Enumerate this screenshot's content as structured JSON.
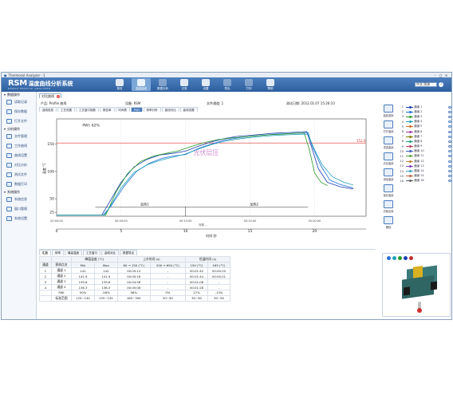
{
  "window": {
    "title": "Thermosol Analyzer - 1"
  },
  "banner": {
    "logo": "RSM",
    "product": "温度曲线分析系统",
    "subtitle": "RENSO PROFILE ANALYZER",
    "tools": [
      {
        "label": "首页",
        "selected": false,
        "dim": false
      },
      {
        "label": "温度曲线",
        "selected": true,
        "dim": false
      },
      {
        "label": "数据分析",
        "selected": false,
        "dim": true
      },
      {
        "label": "记录",
        "selected": false,
        "dim": false
      },
      {
        "label": "设置",
        "selected": false,
        "dim": false
      },
      {
        "label": "导出",
        "selected": false,
        "dim": true
      },
      {
        "label": "打印",
        "selected": false,
        "dim": true
      },
      {
        "label": "帮助",
        "selected": false,
        "dim": false
      }
    ],
    "search_value": "中文 简体"
  },
  "sidebar": {
    "groups": [
      {
        "title": "数据操作",
        "items": [
          "读取记录",
          "保存数据",
          "打开文件"
        ]
      },
      {
        "title": "分析操作",
        "items": [
          "文件管理",
          "工作曲线",
          "曲线设置",
          "对比分析",
          "测试文件",
          "数据打印"
        ]
      },
      {
        "title": "系统操作",
        "items": [
          "系统信息",
          "窗口管理",
          "系统设置"
        ]
      }
    ]
  },
  "tab": {
    "label": "对比曲线"
  },
  "info": {
    "product": "产品: Profile 曲线",
    "device": "设备: RSM",
    "file": "文件通道: 1",
    "date": "测试日期: 2012.01.07 15:26:10"
  },
  "subtabs": [
    "曲线信息",
    "工艺设置",
    "工艺窗口指数",
    "报告单",
    "时间表",
    "PWI",
    "斜率分析",
    "曲线对比",
    "曲线设置"
  ],
  "subtab_active": 5,
  "chart_data": {
    "type": "line",
    "annotation_top": "PWI: 62%",
    "watermark": "光伏层压",
    "ylabel": "温度 °C",
    "xlabel": "时间 秒",
    "yticks": [
      "150",
      "100",
      "50",
      "25"
    ],
    "xticks": [
      "0",
      "5",
      "10",
      "15",
      "20"
    ],
    "time_labels": [
      "00:00:00",
      "00:05:00",
      "00:10:00",
      "00:15:00",
      "00:20:00"
    ],
    "limit_line": {
      "value": 152,
      "label": "152.0"
    },
    "zone_labels": [
      "加热1",
      "加热2"
    ],
    "bottom_zone": "冷却 ...",
    "ylim": [
      18,
      196
    ],
    "xlim": [
      0,
      24
    ],
    "series": [
      {
        "color": "#1a3fb0",
        "values": [
          [
            0,
            20
          ],
          [
            2,
            20
          ],
          [
            3.5,
            20
          ],
          [
            4,
            40
          ],
          [
            5,
            80
          ],
          [
            6,
            108
          ],
          [
            7,
            122
          ],
          [
            8,
            130
          ],
          [
            9,
            133
          ],
          [
            10,
            137
          ],
          [
            11,
            146
          ],
          [
            12,
            154
          ],
          [
            13,
            160
          ],
          [
            14,
            164
          ],
          [
            15,
            166
          ],
          [
            16,
            168
          ],
          [
            17,
            170
          ],
          [
            18,
            171
          ],
          [
            19,
            172
          ],
          [
            19.4,
            173
          ],
          [
            19.7,
            150
          ],
          [
            20.3,
            105
          ],
          [
            21,
            80
          ],
          [
            22,
            72
          ],
          [
            23,
            68
          ]
        ]
      },
      {
        "color": "#1e6fd6",
        "values": [
          [
            0,
            20
          ],
          [
            2,
            20
          ],
          [
            3.6,
            20
          ],
          [
            4.2,
            36
          ],
          [
            5.2,
            72
          ],
          [
            6.2,
            100
          ],
          [
            7.2,
            115
          ],
          [
            8.2,
            124
          ],
          [
            9,
            128
          ],
          [
            10,
            131
          ],
          [
            11,
            142
          ],
          [
            12,
            150
          ],
          [
            13,
            157
          ],
          [
            14,
            161
          ],
          [
            15,
            164
          ],
          [
            16,
            166
          ],
          [
            17,
            168
          ],
          [
            18,
            169
          ],
          [
            19,
            170
          ],
          [
            19.5,
            171
          ],
          [
            19.8,
            148
          ],
          [
            20.5,
            110
          ],
          [
            21.2,
            84
          ],
          [
            22,
            76
          ],
          [
            23,
            70
          ]
        ]
      },
      {
        "color": "#2a9a2a",
        "values": [
          [
            0,
            20
          ],
          [
            2,
            20
          ],
          [
            3.8,
            20
          ],
          [
            4,
            30
          ],
          [
            4.6,
            62
          ],
          [
            5.5,
            96
          ],
          [
            6.5,
            118
          ],
          [
            7.5,
            128
          ],
          [
            8.5,
            133
          ],
          [
            9.5,
            138
          ],
          [
            10.5,
            146
          ],
          [
            11.5,
            153
          ],
          [
            12.5,
            158
          ],
          [
            13.5,
            161
          ],
          [
            14.5,
            163
          ],
          [
            15.5,
            165
          ],
          [
            16.5,
            167
          ],
          [
            17.5,
            168
          ],
          [
            18.5,
            170
          ],
          [
            19.2,
            170
          ],
          [
            19.6,
            140
          ],
          [
            20,
            98
          ],
          [
            20.5,
            80
          ],
          [
            21,
            74
          ]
        ]
      },
      {
        "color": "#1fa0b8",
        "values": [
          [
            0,
            20
          ],
          [
            2,
            20
          ],
          [
            3.7,
            20
          ],
          [
            4.1,
            34
          ],
          [
            5,
            70
          ],
          [
            6,
            98
          ],
          [
            7,
            112
          ],
          [
            8,
            120
          ],
          [
            9,
            126
          ],
          [
            10,
            132
          ],
          [
            11,
            141
          ],
          [
            12,
            149
          ],
          [
            13,
            155
          ],
          [
            14,
            159
          ],
          [
            15,
            162
          ],
          [
            16,
            164
          ],
          [
            17,
            166
          ],
          [
            18,
            167
          ],
          [
            19,
            168
          ],
          [
            19.5,
            168
          ],
          [
            19.9,
            145
          ],
          [
            20.6,
            112
          ],
          [
            21.4,
            90
          ],
          [
            22.3,
            80
          ],
          [
            23,
            75
          ]
        ]
      }
    ]
  },
  "right_tools": [
    "曲线选择",
    "打开曲线",
    "重选曲线",
    "清空曲线",
    "添加曲线",
    "保存曲线",
    "清除区域",
    "删除"
  ],
  "legend": [
    {
      "n": "1",
      "name": "通道 1",
      "color": "#1a3fb0"
    },
    {
      "n": "2",
      "name": "通道 2",
      "color": "#1e6fd6"
    },
    {
      "n": "3",
      "name": "通道 3",
      "color": "#2a9a2a"
    },
    {
      "n": "4",
      "name": "通道 4",
      "color": "#1fa0b8"
    },
    {
      "n": "5",
      "name": "通道 5",
      "color": "#d07020"
    },
    {
      "n": "6",
      "name": "通道 6",
      "color": "#a040a0"
    },
    {
      "n": "7",
      "name": "通道 7",
      "color": "#808000"
    },
    {
      "n": "8",
      "name": "通道 8",
      "color": "#20a080"
    },
    {
      "n": "9",
      "name": "通道 9",
      "color": "#c04060"
    },
    {
      "n": "10",
      "name": "通道 10",
      "color": "#4060c0"
    },
    {
      "n": "11",
      "name": "通道 11",
      "color": "#60a040"
    },
    {
      "n": "12",
      "name": "通道 12",
      "color": "#c08040"
    },
    {
      "n": "13",
      "name": "通道 13",
      "color": "#8040c0"
    },
    {
      "n": "14",
      "name": "通道 14",
      "color": "#40a0c0"
    },
    {
      "n": "15",
      "name": "通道 15",
      "color": "#c06040"
    },
    {
      "n": "16",
      "name": "通道 16",
      "color": "#606060"
    }
  ],
  "bottom_tabs": [
    "汇总",
    "斜率",
    "最高温度",
    "工艺窗口",
    "曲线对比",
    "数据导出"
  ],
  "table": {
    "header1": [
      "",
      "",
      "峰值温度 (°C)",
      "",
      "上升时间 (s)",
      "",
      "恒温时间 (s)",
      ""
    ],
    "header2": [
      "通道",
      "探测点名",
      "Min",
      "Max",
      "60 → 150 (°C)",
      "200 → 650 (°C)",
      "150 (°C)",
      "165 (°C)"
    ],
    "rows": [
      [
        "1",
        "通道 1",
        "142",
        "142",
        "00:05:12",
        "-",
        "00:01:42",
        "00:00:20"
      ],
      [
        "2",
        "通道 2",
        "141.9",
        "141.9",
        "00:05:18",
        "-",
        "00:01:44",
        "00:00:21"
      ],
      [
        "3",
        "通道 3",
        "139.6",
        "139.6",
        "00:04:56",
        "-",
        "00:01:08",
        "-"
      ],
      [
        "4",
        "通道 4",
        "136.3",
        "136.3",
        "00:05:06",
        "-",
        "00:01:28",
        "-"
      ],
      [
        "",
        "PWI",
        "50%",
        "-56%",
        "56%",
        "0%",
        "27%",
        "-13%"
      ],
      [
        "",
        "标准范围",
        "125~140",
        "135~145",
        "180~300",
        "30~90",
        "30~90",
        "30~90"
      ]
    ]
  },
  "preview": {
    "dot_colors": [
      "#2a6fd6",
      "#1fa0b8",
      "#2a9a2a",
      "#1a3fb0",
      "#c03030"
    ]
  }
}
